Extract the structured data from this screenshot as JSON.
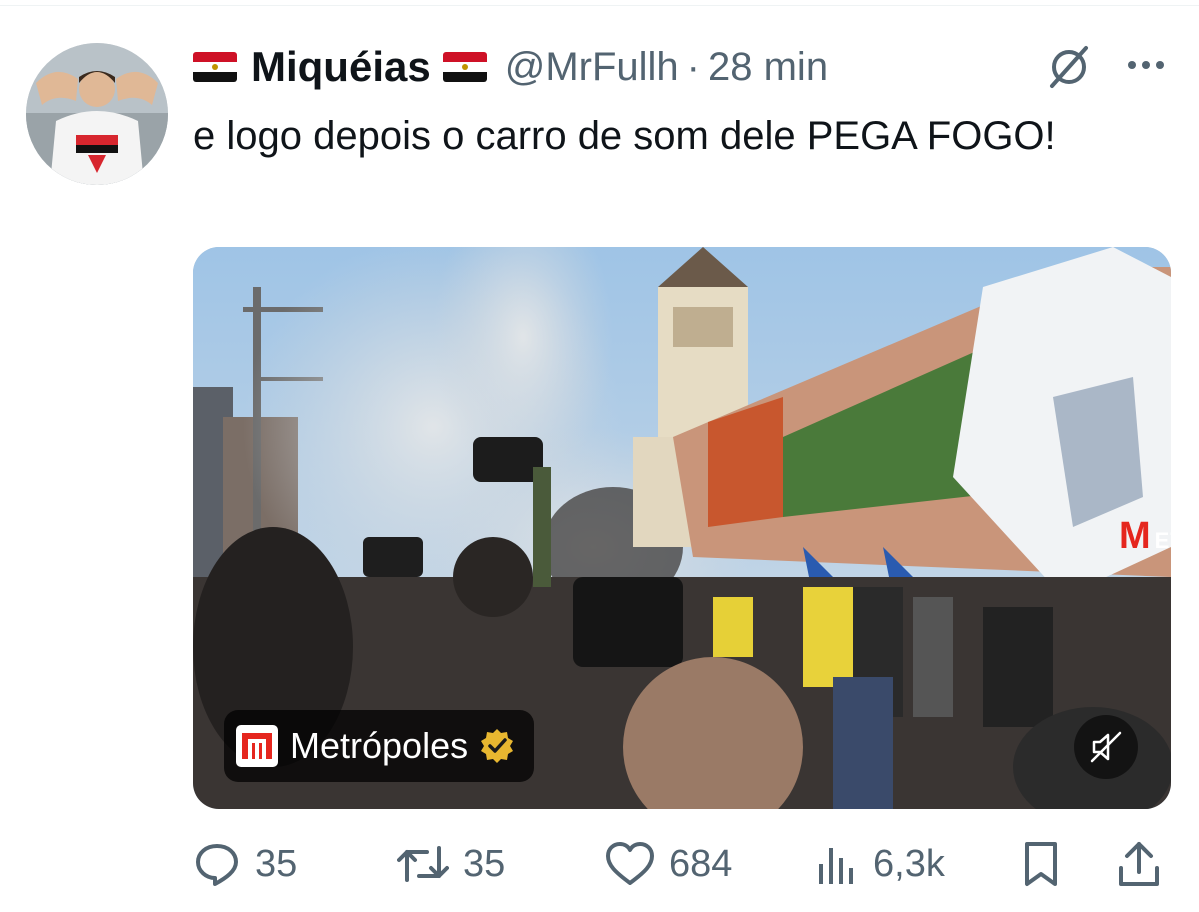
{
  "tweet": {
    "author_name": "Miquéias",
    "handle": "@MrFullh",
    "separator": "·",
    "time": "28 min",
    "text": "e logo depois o carro de som dele PEGA FOGO!"
  },
  "media": {
    "watermark_letter": "M",
    "watermark_text": "ETRÓPOLES",
    "source_name": "Metrópoles"
  },
  "actions": {
    "replies": "35",
    "reposts": "35",
    "likes": "684",
    "views": "6,3k"
  },
  "icons": {
    "flag": "egypt-flag-icon",
    "grok": "grok-icon",
    "more": "more-icon",
    "verified": "verified-badge-icon",
    "mute": "mute-icon",
    "reply": "reply-icon",
    "repost": "repost-icon",
    "like": "heart-icon",
    "views": "views-icon",
    "bookmark": "bookmark-icon",
    "share": "share-icon"
  },
  "colors": {
    "text_primary": "#0f1419",
    "text_secondary": "#536471",
    "verified_gold": "#e8b730",
    "brand_red": "#e5261e"
  }
}
